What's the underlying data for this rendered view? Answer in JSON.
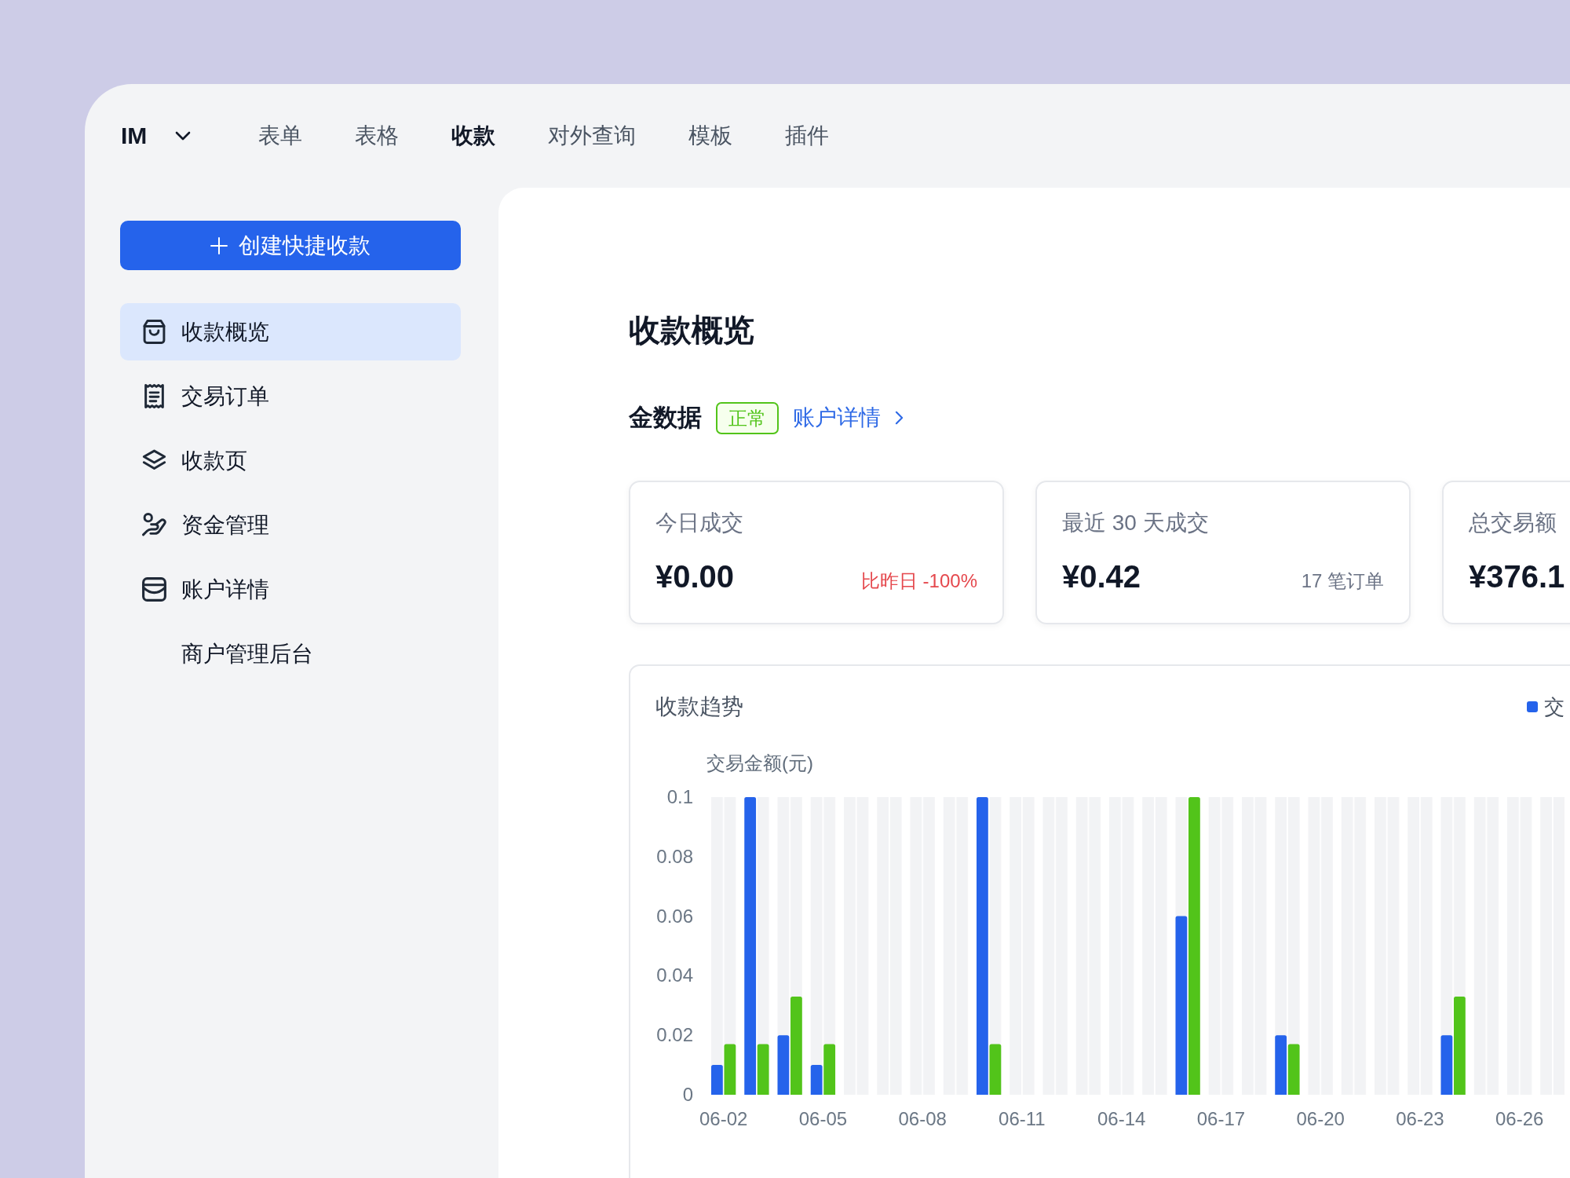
{
  "app_switcher": {
    "label": "IM"
  },
  "nav_tabs": [
    {
      "label": "表单",
      "selected": false
    },
    {
      "label": "表格",
      "selected": false
    },
    {
      "label": "收款",
      "selected": true
    },
    {
      "label": "对外查询",
      "selected": false
    },
    {
      "label": "模板",
      "selected": false
    },
    {
      "label": "插件",
      "selected": false
    }
  ],
  "sidebar": {
    "create_button": {
      "label": "创建快捷收款"
    },
    "items": [
      {
        "label": "收款概览",
        "selected": true
      },
      {
        "label": "交易订单",
        "selected": false
      },
      {
        "label": "收款页",
        "selected": false
      },
      {
        "label": "资金管理",
        "selected": false
      },
      {
        "label": "账户详情",
        "selected": false
      },
      {
        "label": "商户管理后台",
        "selected": false
      }
    ]
  },
  "main": {
    "title": "收款概览",
    "account": {
      "name": "金数据",
      "status": "正常",
      "link": "账户详情"
    },
    "stats": [
      {
        "label": "今日成交",
        "value": "¥0.00",
        "note": {
          "text": "比昨日 -100%",
          "negative": true
        }
      },
      {
        "label": "最近 30 天成交",
        "value": "¥0.42",
        "note": {
          "text": "17 笔订单",
          "negative": false
        }
      },
      {
        "label": "总交易额",
        "value": "¥376.1"
      }
    ],
    "trend": {
      "chart_data": {
        "type": "bar",
        "title": "收款趋势",
        "ylabel": "交易金额(元)",
        "categories": [
          "06-02",
          null,
          null,
          "06-05",
          null,
          null,
          "06-08",
          null,
          null,
          "06-11",
          null,
          null,
          "06-14",
          null,
          null,
          "06-17",
          null,
          null,
          "06-20",
          null,
          null,
          "06-23",
          null,
          null,
          "06-26",
          null
        ],
        "ylim": [
          0,
          0.1
        ],
        "yticks": [
          0,
          0.02,
          0.04,
          0.06,
          0.08,
          0.1
        ],
        "series": [
          {
            "name": "交",
            "color": "#2563eb",
            "values": [
              0.01,
              0.1,
              0.02,
              0.01,
              0,
              0,
              0,
              0,
              0.1,
              0,
              0,
              0,
              0,
              0,
              0.06,
              0,
              0,
              0.02,
              0,
              0,
              0,
              0,
              0.02,
              0,
              0,
              0
            ]
          },
          {
            "color": "#52c41a",
            "values": [
              0.017,
              0.017,
              0.033,
              0.017,
              0,
              0,
              0,
              0,
              0.017,
              0,
              0,
              0,
              0,
              0,
              0.1,
              0,
              0,
              0.017,
              0,
              0,
              0,
              0,
              0.033,
              0,
              0,
              0
            ]
          }
        ]
      }
    }
  }
}
